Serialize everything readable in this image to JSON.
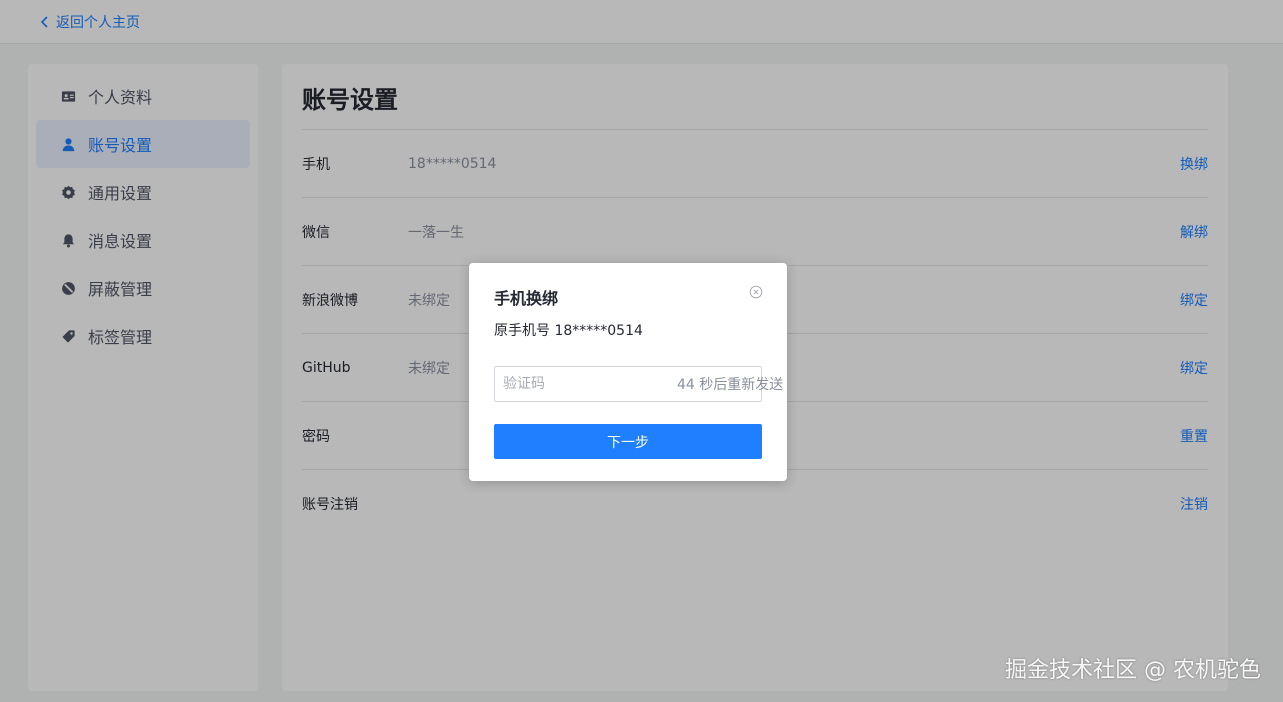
{
  "header": {
    "back_label": "返回个人主页"
  },
  "sidebar": {
    "items": [
      {
        "label": "个人资料",
        "icon": "id-card-icon"
      },
      {
        "label": "账号设置",
        "icon": "user-icon",
        "active": true
      },
      {
        "label": "通用设置",
        "icon": "gear-icon"
      },
      {
        "label": "消息设置",
        "icon": "bell-icon"
      },
      {
        "label": "屏蔽管理",
        "icon": "block-icon"
      },
      {
        "label": "标签管理",
        "icon": "tag-icon"
      }
    ]
  },
  "main": {
    "title": "账号设置",
    "rows": [
      {
        "label": "手机",
        "value": "18*****0514",
        "action": "换绑"
      },
      {
        "label": "微信",
        "value": "一落一生",
        "action": "解绑"
      },
      {
        "label": "新浪微博",
        "value": "未绑定",
        "action": "绑定"
      },
      {
        "label": "GitHub",
        "value": "未绑定",
        "action": "绑定"
      },
      {
        "label": "密码",
        "value": "",
        "action": "重置"
      },
      {
        "label": "账号注销",
        "value": "",
        "action": "注销"
      }
    ]
  },
  "modal": {
    "title": "手机换绑",
    "subtitle": "原手机号 18*****0514",
    "code_placeholder": "验证码",
    "code_value": "",
    "countdown": "44 秒后重新发送",
    "next_label": "下一步"
  },
  "watermark": "掘金技术社区 @ 农机驼色",
  "colors": {
    "accent": "#1e80ff",
    "active_bg": "#eaf2ff"
  }
}
